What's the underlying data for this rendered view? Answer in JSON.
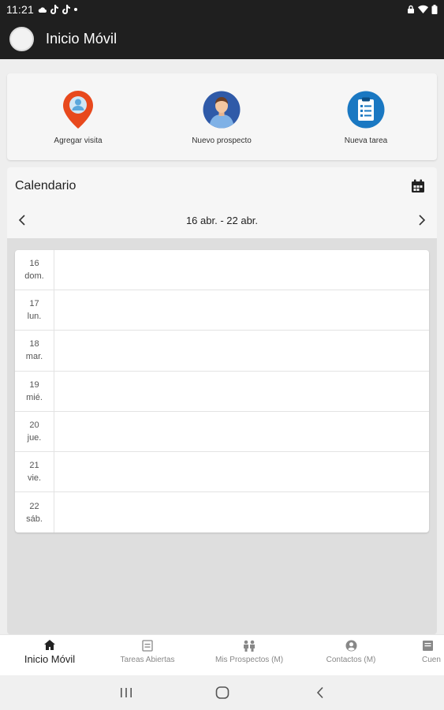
{
  "status_bar": {
    "time": "11:21",
    "icons_left": [
      "cloud-icon",
      "tiktok-icon",
      "tiktok-icon",
      "dot-icon"
    ],
    "icons_right": [
      "lock-icon",
      "wifi-icon",
      "battery-icon"
    ]
  },
  "app_bar": {
    "title": "Inicio Móvil",
    "avatar_icon": "avatar"
  },
  "actions": [
    {
      "label": "Agregar visita",
      "icon": "location-pin-icon",
      "color": "#e8491d"
    },
    {
      "label": "Nuevo prospecto",
      "icon": "person-icon",
      "color": "#2f5aa8"
    },
    {
      "label": "Nueva tarea",
      "icon": "clipboard-icon",
      "color": "#1a78c2"
    }
  ],
  "calendar": {
    "title": "Calendario",
    "icon": "calendar-icon",
    "range": "16 abr. - 22 abr.",
    "days": [
      {
        "num": "16",
        "name": "dom."
      },
      {
        "num": "17",
        "name": "lun."
      },
      {
        "num": "18",
        "name": "mar."
      },
      {
        "num": "19",
        "name": "mié."
      },
      {
        "num": "20",
        "name": "jue."
      },
      {
        "num": "21",
        "name": "vie."
      },
      {
        "num": "22",
        "name": "sáb."
      }
    ]
  },
  "bottom_nav": [
    {
      "label": "Inicio Móvil",
      "icon": "home-icon",
      "active": true
    },
    {
      "label": "Tareas Abiertas",
      "icon": "tasks-icon",
      "active": false
    },
    {
      "label": "Mis Prospectos (M)",
      "icon": "people-icon",
      "active": false
    },
    {
      "label": "Contactos (M)",
      "icon": "contact-icon",
      "active": false
    },
    {
      "label": "Cuen",
      "icon": "account-icon",
      "active": false
    }
  ],
  "system_nav": {
    "recents": "recents-icon",
    "home": "home-circle-icon",
    "back": "back-icon"
  },
  "colors": {
    "app_bar": "#1f1f1f",
    "background": "#eeeeee",
    "card": "#f6f6f6",
    "active_nav": "#222222",
    "inactive_nav": "#888888"
  }
}
